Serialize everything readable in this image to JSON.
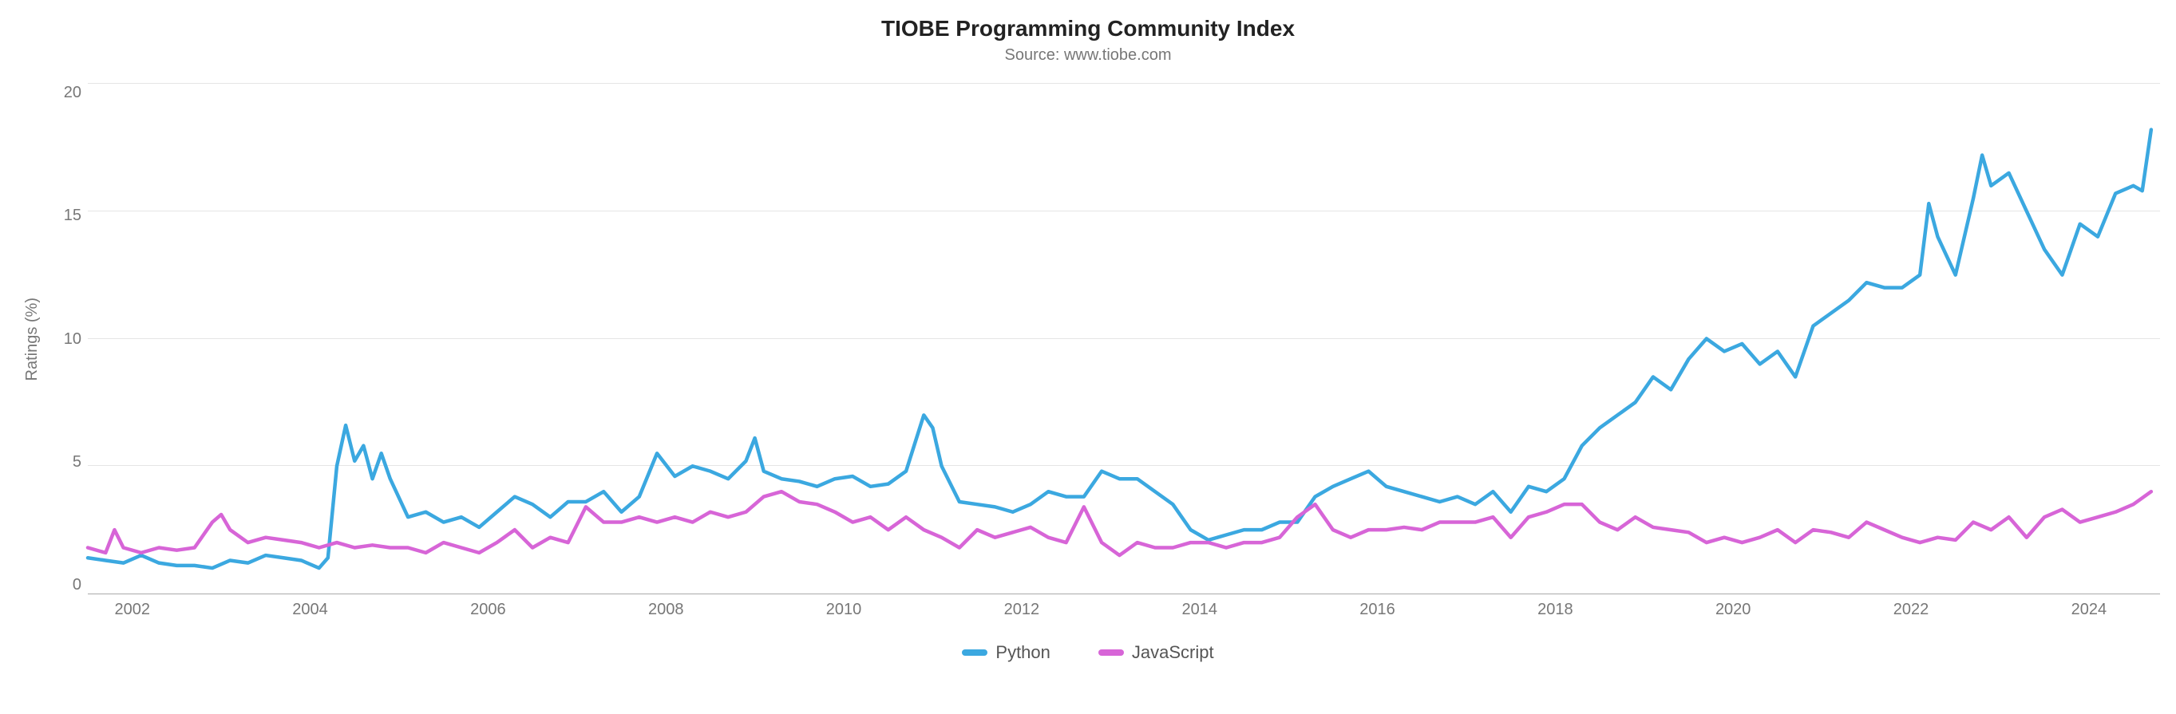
{
  "chart_data": {
    "type": "line",
    "title": "TIOBE Programming Community Index",
    "subtitle": "Source: www.tiobe.com",
    "xlabel": "",
    "ylabel": "Ratings (%)",
    "x_range": [
      2001.5,
      2024.8
    ],
    "ylim": [
      0,
      20
    ],
    "x_ticks": [
      2002,
      2004,
      2006,
      2008,
      2010,
      2012,
      2014,
      2016,
      2018,
      2020,
      2022,
      2024
    ],
    "y_ticks": [
      0,
      5,
      10,
      15,
      20
    ],
    "legend_position": "bottom",
    "grid": true,
    "series": [
      {
        "name": "Python",
        "color": "#3ba8e0",
        "x": [
          2001.5,
          2001.7,
          2001.9,
          2002.1,
          2002.3,
          2002.5,
          2002.7,
          2002.9,
          2003.1,
          2003.3,
          2003.5,
          2003.7,
          2003.9,
          2004.1,
          2004.2,
          2004.3,
          2004.4,
          2004.5,
          2004.6,
          2004.7,
          2004.8,
          2004.9,
          2005.1,
          2005.3,
          2005.5,
          2005.7,
          2005.9,
          2006.1,
          2006.3,
          2006.5,
          2006.7,
          2006.9,
          2007.1,
          2007.3,
          2007.5,
          2007.7,
          2007.9,
          2008.1,
          2008.3,
          2008.5,
          2008.7,
          2008.9,
          2009.0,
          2009.1,
          2009.3,
          2009.5,
          2009.7,
          2009.9,
          2010.1,
          2010.3,
          2010.5,
          2010.7,
          2010.9,
          2011.0,
          2011.1,
          2011.3,
          2011.5,
          2011.7,
          2011.9,
          2012.1,
          2012.3,
          2012.5,
          2012.7,
          2012.9,
          2013.1,
          2013.3,
          2013.5,
          2013.7,
          2013.9,
          2014.1,
          2014.3,
          2014.5,
          2014.7,
          2014.9,
          2015.1,
          2015.3,
          2015.5,
          2015.7,
          2015.9,
          2016.1,
          2016.3,
          2016.5,
          2016.7,
          2016.9,
          2017.1,
          2017.3,
          2017.5,
          2017.7,
          2017.9,
          2018.1,
          2018.3,
          2018.5,
          2018.7,
          2018.9,
          2019.1,
          2019.3,
          2019.5,
          2019.7,
          2019.9,
          2020.1,
          2020.3,
          2020.5,
          2020.7,
          2020.9,
          2021.1,
          2021.3,
          2021.5,
          2021.7,
          2021.9,
          2022.1,
          2022.2,
          2022.3,
          2022.5,
          2022.7,
          2022.8,
          2022.9,
          2023.1,
          2023.3,
          2023.5,
          2023.7,
          2023.9,
          2024.1,
          2024.3,
          2024.5,
          2024.6,
          2024.7
        ],
        "values": [
          1.4,
          1.3,
          1.2,
          1.5,
          1.2,
          1.1,
          1.1,
          1.0,
          1.3,
          1.2,
          1.5,
          1.4,
          1.3,
          1.0,
          1.4,
          5.0,
          6.6,
          5.2,
          5.8,
          4.5,
          5.5,
          4.5,
          3.0,
          3.2,
          2.8,
          3.0,
          2.6,
          3.2,
          3.8,
          3.5,
          3.0,
          3.6,
          3.6,
          4.0,
          3.2,
          3.8,
          5.5,
          4.6,
          5.0,
          4.8,
          4.5,
          5.2,
          6.1,
          4.8,
          4.5,
          4.4,
          4.2,
          4.5,
          4.6,
          4.2,
          4.3,
          4.8,
          7.0,
          6.5,
          5.0,
          3.6,
          3.5,
          3.4,
          3.2,
          3.5,
          4.0,
          3.8,
          3.8,
          4.8,
          4.5,
          4.5,
          4.0,
          3.5,
          2.5,
          2.1,
          2.3,
          2.5,
          2.5,
          2.8,
          2.8,
          3.8,
          4.2,
          4.5,
          4.8,
          4.2,
          4.0,
          3.8,
          3.6,
          3.8,
          3.5,
          4.0,
          3.2,
          4.2,
          4.0,
          4.5,
          5.8,
          6.5,
          7.0,
          7.5,
          8.5,
          8.0,
          9.2,
          10.0,
          9.5,
          9.8,
          9.0,
          9.5,
          8.5,
          10.5,
          11.0,
          11.5,
          12.2,
          12.0,
          12.0,
          12.5,
          15.3,
          14.0,
          12.5,
          15.5,
          17.2,
          16.0,
          16.5,
          15.0,
          13.5,
          12.5,
          14.5,
          14.0,
          15.7,
          16.0,
          15.8,
          18.2
        ]
      },
      {
        "name": "JavaScript",
        "color": "#d765d7",
        "x": [
          2001.5,
          2001.7,
          2001.8,
          2001.9,
          2002.1,
          2002.3,
          2002.5,
          2002.7,
          2002.9,
          2003.0,
          2003.1,
          2003.3,
          2003.5,
          2003.7,
          2003.9,
          2004.1,
          2004.3,
          2004.5,
          2004.7,
          2004.9,
          2005.1,
          2005.3,
          2005.5,
          2005.7,
          2005.9,
          2006.1,
          2006.3,
          2006.5,
          2006.7,
          2006.9,
          2007.1,
          2007.3,
          2007.5,
          2007.7,
          2007.9,
          2008.1,
          2008.3,
          2008.5,
          2008.7,
          2008.9,
          2009.1,
          2009.3,
          2009.5,
          2009.7,
          2009.9,
          2010.1,
          2010.3,
          2010.5,
          2010.7,
          2010.9,
          2011.1,
          2011.3,
          2011.5,
          2011.7,
          2011.9,
          2012.1,
          2012.3,
          2012.5,
          2012.7,
          2012.9,
          2013.1,
          2013.3,
          2013.5,
          2013.7,
          2013.9,
          2014.1,
          2014.3,
          2014.5,
          2014.7,
          2014.9,
          2015.1,
          2015.3,
          2015.5,
          2015.7,
          2015.9,
          2016.1,
          2016.3,
          2016.5,
          2016.7,
          2016.9,
          2017.1,
          2017.3,
          2017.5,
          2017.7,
          2017.9,
          2018.1,
          2018.3,
          2018.5,
          2018.7,
          2018.9,
          2019.1,
          2019.3,
          2019.5,
          2019.7,
          2019.9,
          2020.1,
          2020.3,
          2020.5,
          2020.7,
          2020.9,
          2021.1,
          2021.3,
          2021.5,
          2021.7,
          2021.9,
          2022.1,
          2022.3,
          2022.5,
          2022.7,
          2022.9,
          2023.1,
          2023.3,
          2023.5,
          2023.7,
          2023.9,
          2024.1,
          2024.3,
          2024.5,
          2024.7
        ],
        "values": [
          1.8,
          1.6,
          2.5,
          1.8,
          1.6,
          1.8,
          1.7,
          1.8,
          2.8,
          3.1,
          2.5,
          2.0,
          2.2,
          2.1,
          2.0,
          1.8,
          2.0,
          1.8,
          1.9,
          1.8,
          1.8,
          1.6,
          2.0,
          1.8,
          1.6,
          2.0,
          2.5,
          1.8,
          2.2,
          2.0,
          3.4,
          2.8,
          2.8,
          3.0,
          2.8,
          3.0,
          2.8,
          3.2,
          3.0,
          3.2,
          3.8,
          4.0,
          3.6,
          3.5,
          3.2,
          2.8,
          3.0,
          2.5,
          3.0,
          2.5,
          2.2,
          1.8,
          2.5,
          2.2,
          2.4,
          2.6,
          2.2,
          2.0,
          3.4,
          2.0,
          1.5,
          2.0,
          1.8,
          1.8,
          2.0,
          2.0,
          1.8,
          2.0,
          2.0,
          2.2,
          3.0,
          3.5,
          2.5,
          2.2,
          2.5,
          2.5,
          2.6,
          2.5,
          2.8,
          2.8,
          2.8,
          3.0,
          2.2,
          3.0,
          3.2,
          3.5,
          3.5,
          2.8,
          2.5,
          3.0,
          2.6,
          2.5,
          2.4,
          2.0,
          2.2,
          2.0,
          2.2,
          2.5,
          2.0,
          2.5,
          2.4,
          2.2,
          2.8,
          2.5,
          2.2,
          2.0,
          2.2,
          2.1,
          2.8,
          2.5,
          3.0,
          2.2,
          3.0,
          3.3,
          2.8,
          3.0,
          3.2,
          3.5,
          4.0
        ]
      }
    ]
  }
}
